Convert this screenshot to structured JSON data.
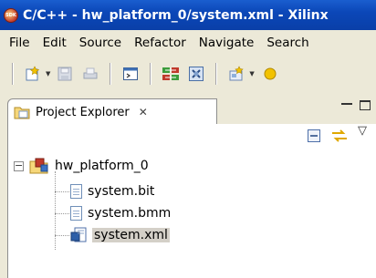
{
  "titlebar": {
    "title": "C/C++ - hw_platform_0/system.xml - Xilinx",
    "app_icon_text": "SDK"
  },
  "menu": [
    "File",
    "Edit",
    "Source",
    "Refactor",
    "Navigate",
    "Search"
  ],
  "toolbar": {
    "buttons": [
      "new-icon",
      "save-icon",
      "print-icon",
      "console-icon",
      "build-icon",
      "debug-icon",
      "new-project-icon"
    ]
  },
  "view": {
    "tab_label": "Project Explorer",
    "tab_close": "✕",
    "collapse_all": "collapse-all-icon",
    "link_editor": "link-with-editor-icon",
    "view_menu": "▽"
  },
  "tree": {
    "project": {
      "label": "hw_platform_0",
      "expander": "−"
    },
    "files": [
      {
        "label": "system.bit",
        "selected": false
      },
      {
        "label": "system.bmm",
        "selected": false
      },
      {
        "label": "system.xml",
        "selected": true
      }
    ]
  },
  "colors": {
    "titlebar": "#0b47b8",
    "selection": "#d4d0c8",
    "panel_bg": "#ece9d8"
  }
}
